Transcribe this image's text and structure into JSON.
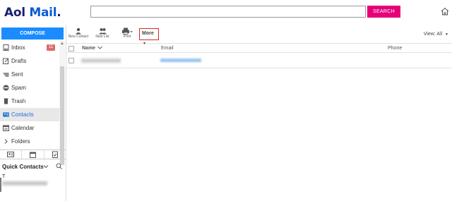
{
  "header": {
    "logo_prefix": "Aol",
    "logo_main": "Mail",
    "logo_dot": ".",
    "search_placeholder": "",
    "search_button": "SEARCH",
    "home_icon": "home-icon"
  },
  "sidebar": {
    "compose_label": "COMPOSE",
    "items": [
      {
        "label": "Inbox",
        "icon": "inbox-icon",
        "badge": "11"
      },
      {
        "label": "Drafts",
        "icon": "drafts-icon"
      },
      {
        "label": "Sent",
        "icon": "sent-icon"
      },
      {
        "label": "Spam",
        "icon": "spam-icon"
      },
      {
        "label": "Trash",
        "icon": "trash-icon"
      },
      {
        "label": "Contacts",
        "icon": "contacts-icon",
        "active": true
      },
      {
        "label": "Calendar",
        "icon": "calendar-icon"
      },
      {
        "label": "Folders",
        "icon": "chevron-right-icon"
      }
    ],
    "bottom_tabs": [
      "contact-card-icon",
      "calendar-icon",
      "tasks-icon"
    ],
    "quick_contacts_label": "Quick Contacts",
    "quick_contacts_letter": "T"
  },
  "toolbar": {
    "new_contact": "New Contact",
    "new_list": "New List",
    "print": "Print",
    "more": "More",
    "view_all": "View: All"
  },
  "table": {
    "headers": {
      "name": "Name",
      "email": "Email",
      "phone": "Phone"
    }
  },
  "colors": {
    "brand": "#1a1f71",
    "accent_blue": "#1a8cff",
    "search_pink": "#e6007a",
    "badge_red": "#e06a6a",
    "highlight_red": "#d9262b"
  }
}
